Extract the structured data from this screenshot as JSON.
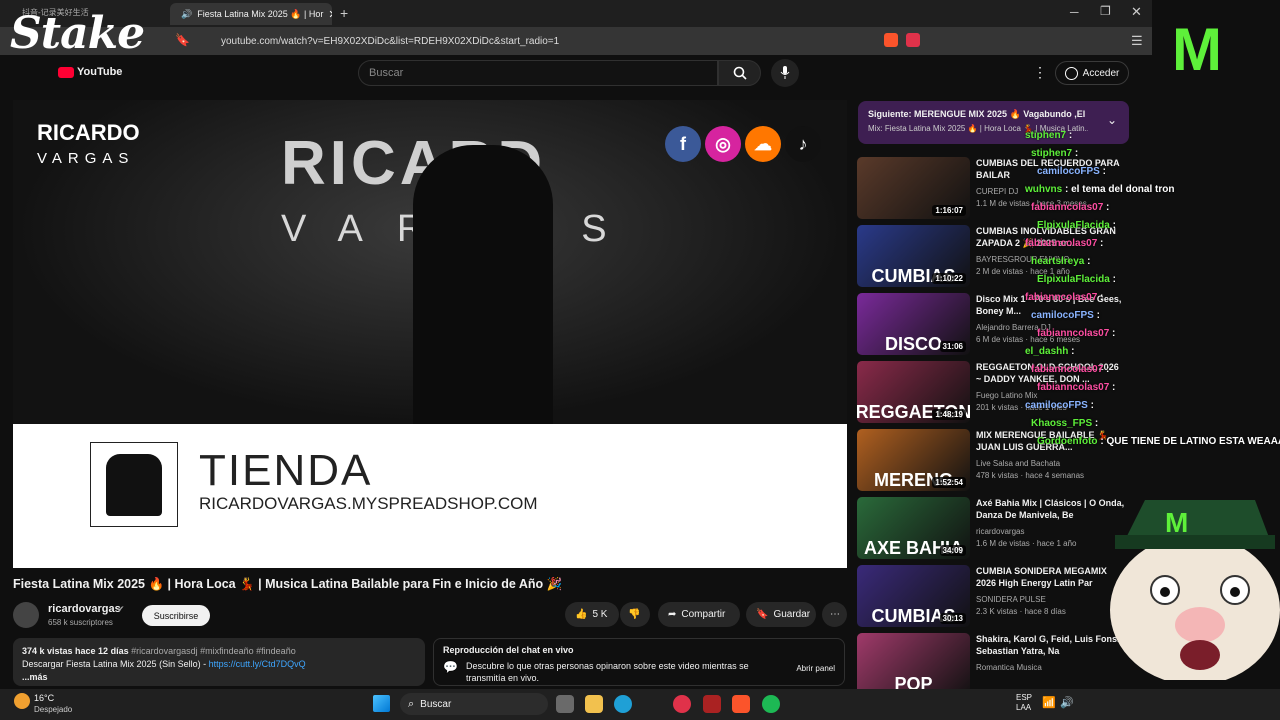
{
  "browser": {
    "tab_title": "Fiesta Latina Mix 2025 🔥 | Hor",
    "url": "youtube.com/watch?v=EH9X02XDiDc&list=RDEH9X02XDiDc&start_radio=1",
    "inactive_tab": "抖音-记录美好生活"
  },
  "overlay": {
    "stake_logo": "Stake",
    "monster_logo": "M"
  },
  "header": {
    "logo": "YouTube",
    "search_placeholder": "Buscar",
    "signin_label": "Acceder"
  },
  "video": {
    "logo_line1": "RICARDO",
    "logo_line2": "VARGAS",
    "wall_line1": "RICARD",
    "wall_line2": "VARGAS",
    "banner_title": "TIENDA",
    "banner_url": "RICARDOVARGAS.MYSPREADSHOP.COM"
  },
  "meta": {
    "title": "Fiesta Latina Mix 2025 🔥 | Hora Loca 💃 | Musica Latina Bailable para Fin e Inicio de Año 🎉",
    "channel": "ricardovargas",
    "subscribers": "658 k suscriptores",
    "subscribe_label": "Suscribirse",
    "likes": "5 K",
    "share_label": "Compartir",
    "save_label": "Guardar"
  },
  "description": {
    "stats": "374 k vistas  hace 12 días",
    "hashtags": "#ricardovargasdj #mixfindeaño #findeaño",
    "line2_text": "Descargar Fiesta Latina Mix 2025 (Sin Sello) - ",
    "line2_link": "https://cutt.ly/Ctd7DQvQ",
    "more": "...más"
  },
  "livechat": {
    "title": "Reproducción del chat en vivo",
    "text": "Descubre lo que otras personas opinaron sobre este video mientras se transmitía en vivo.",
    "open_label": "Abrir panel"
  },
  "playlist_next": {
    "line1": "Siguiente: MERENGUE MIX 2025 🔥 Vagabundo ,El ...",
    "line2": "Mix: Fiesta Latina Mix 2025 🔥 | Hora Loca 💃 | Musica Latin..."
  },
  "recommendations": [
    {
      "title": "CUMBIAS DEL RECUERDO PARA BAILAR",
      "channel": "CUREPI DJ",
      "stats": "1.1 M de vistas · hace 3 meses",
      "duration": "1:16:07",
      "thumb_text": "",
      "color": "#5a3a2a"
    },
    {
      "title": "CUMBIAS INOLVIDABLES GRAN ZAPADA 2 🎉 2025 ar...",
      "channel": "BAYRESGROUP ENVIVO",
      "stats": "2 M de vistas · hace 1 año",
      "duration": "1:10:22",
      "thumb_text": "CUMBIAS",
      "color": "#2a3a8a"
    },
    {
      "title": "Disco Mix 1 - 70's 80's | Bee Gees, Boney M...",
      "channel": "Alejandro Barrera DJ",
      "stats": "6 M de vistas · hace 6 meses",
      "duration": "31:06",
      "thumb_text": "DISCO",
      "color": "#7a2a9a"
    },
    {
      "title": "REGGAETON OLD SCHOOL 2026 ~ DADDY YANKEE, DON ...",
      "channel": "Fuego Latino Mix",
      "stats": "201 k vistas · hace 1 mes",
      "duration": "1:48:19",
      "thumb_text": "REGGAETON",
      "color": "#8a2a4a"
    },
    {
      "title": "MIX MERENGUE BAILABLE 💃 JUAN LUIS GUERRA...",
      "channel": "Live Salsa and Bachata",
      "stats": "478 k vistas · hace 4 semanas",
      "duration": "1:52:54",
      "thumb_text": "MERENG",
      "color": "#b06020"
    },
    {
      "title": "Axé Bahia Mix | Clásicos | O Onda, Danza De Manivela, Be",
      "channel": "ricardovargas",
      "stats": "1.6 M de vistas · hace 1 año",
      "duration": "34:09",
      "thumb_text": "AXE BAHIA",
      "color": "#2a6a3a"
    },
    {
      "title": "CUMBIA SONIDERA MEGAMIX 2026 High Energy Latin Par",
      "channel": "SONIDERA PULSE",
      "stats": "2.3 K vistas · hace 8 días",
      "duration": "30:13",
      "thumb_text": "CUMBIAS",
      "color": "#3a2a7a"
    },
    {
      "title": "Shakira, Karol G, Feid, Luis Fonsi, Sebastian Yatra, Na",
      "channel": "Romantica Musica",
      "stats": "",
      "duration": "",
      "thumb_text": "POP",
      "color": "#a03a6a"
    }
  ],
  "chat_overlay": [
    {
      "user": "stiphen7",
      "msg": ""
    },
    {
      "user": "stiphen7",
      "msg": ""
    },
    {
      "user": "camilocoFPS",
      "msg": ""
    },
    {
      "user": "wuhvns",
      "msg": "el tema del donal tron"
    },
    {
      "user": "fabianncolas07",
      "msg": ""
    },
    {
      "user": "ElpixulaFlacida",
      "msg": ""
    },
    {
      "user": "fabianncolas07",
      "msg": ""
    },
    {
      "user": "heartslreya",
      "msg": ""
    },
    {
      "user": "ElpixulaFlacida",
      "msg": ""
    },
    {
      "user": "fabianncolas07",
      "msg": ""
    },
    {
      "user": "camilocoFPS",
      "msg": ""
    },
    {
      "user": "fabianncolas07",
      "msg": ""
    },
    {
      "user": "el_dashh",
      "msg": ""
    },
    {
      "user": "fabianncolas07",
      "msg": ""
    },
    {
      "user": "fabianncolas07",
      "msg": ""
    },
    {
      "user": "camilocoFPS",
      "msg": ""
    },
    {
      "user": "Khaoss_FPS",
      "msg": ""
    },
    {
      "user": "Gordoenfoto",
      "msg": "QUE TIENE DE LATINO ESTA WEAAA"
    }
  ],
  "taskbar": {
    "temp": "16°C",
    "weather": "Despejado",
    "search": "Buscar",
    "lang1": "ESP",
    "lang2": "LAA"
  },
  "colors": {
    "accent_red": "#ff0033",
    "chat_green": "#5ef03a",
    "chat_pink": "#ff4fa3",
    "next_bg": "#3e1f52"
  }
}
